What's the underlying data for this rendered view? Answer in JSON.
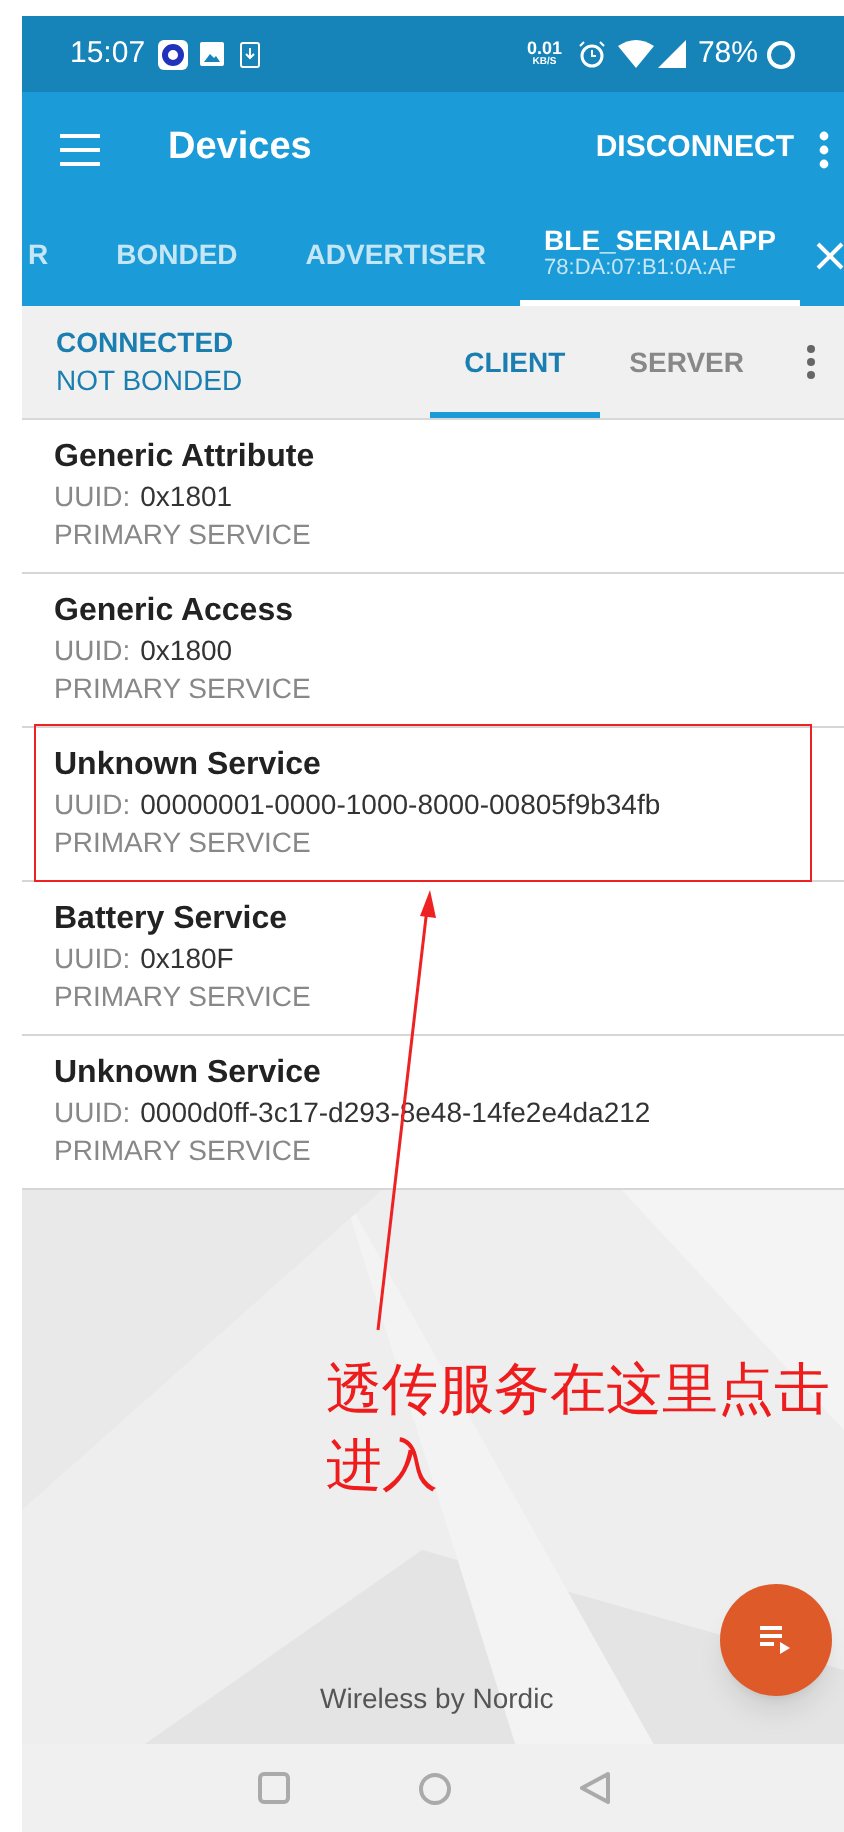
{
  "status_bar": {
    "time": "15:07",
    "net_speed": "0.01",
    "net_unit": "KB/S",
    "battery": "78%"
  },
  "app_bar": {
    "title": "Devices",
    "action": "DISCONNECT"
  },
  "tabs": [
    {
      "label": "R",
      "selected": false
    },
    {
      "label": "BONDED",
      "selected": false
    },
    {
      "label": "ADVERTISER",
      "selected": false
    },
    {
      "label": "BLE_SERIALAPP",
      "address": "78:DA:07:B1:0A:AF",
      "selected": true
    }
  ],
  "connection": {
    "state": "CONNECTED",
    "bond": "NOT BONDED"
  },
  "sub_tabs": [
    {
      "label": "CLIENT",
      "selected": true
    },
    {
      "label": "SERVER",
      "selected": false
    }
  ],
  "services": [
    {
      "name": "Generic Attribute",
      "uuid_label": "UUID:",
      "uuid": "0x1801",
      "type": "PRIMARY SERVICE",
      "highlighted": false
    },
    {
      "name": "Generic Access",
      "uuid_label": "UUID:",
      "uuid": "0x1800",
      "type": "PRIMARY SERVICE",
      "highlighted": false
    },
    {
      "name": "Unknown Service",
      "uuid_label": "UUID:",
      "uuid": "00000001-0000-1000-8000-00805f9b34fb",
      "type": "PRIMARY SERVICE",
      "highlighted": true
    },
    {
      "name": "Battery Service",
      "uuid_label": "UUID:",
      "uuid": "0x180F",
      "type": "PRIMARY SERVICE",
      "highlighted": false
    },
    {
      "name": "Unknown Service",
      "uuid_label": "UUID:",
      "uuid": "0000d0ff-3c17-d293-8e48-14fe2e4da212",
      "type": "PRIMARY SERVICE",
      "highlighted": false
    }
  ],
  "annotation": {
    "text": "透传服务在这里点击进入"
  },
  "footer": "Wireless by Nordic"
}
